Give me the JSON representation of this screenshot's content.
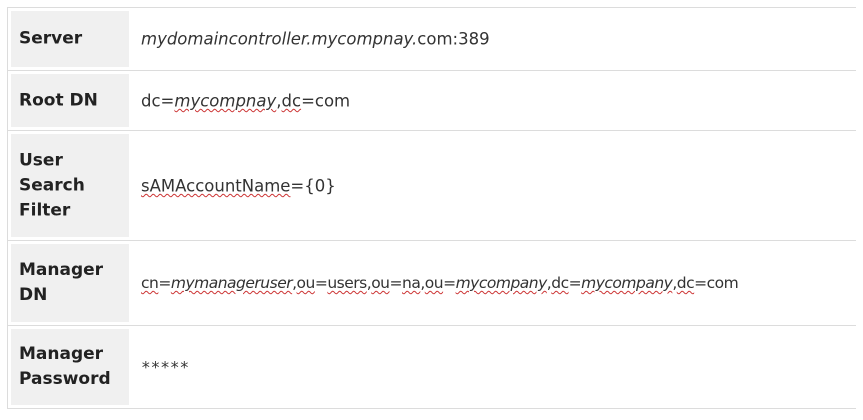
{
  "rows": [
    {
      "label": "Server",
      "value_parts": [
        {
          "text": "mydomaincontroller.mycompnay.",
          "style": "it"
        },
        {
          "text": "com:389",
          "style": ""
        }
      ]
    },
    {
      "label": "Root DN",
      "value_parts": [
        {
          "text": "dc=",
          "style": ""
        },
        {
          "text": "mycompnay",
          "style": "it sq"
        },
        {
          "text": ",",
          "style": ""
        },
        {
          "text": "dc",
          "style": "sq"
        },
        {
          "text": "=com",
          "style": ""
        }
      ]
    },
    {
      "label": "User\nSearch\nFilter",
      "value_parts": [
        {
          "text": "sAMAccountName",
          "style": "sq"
        },
        {
          "text": "={0}",
          "style": ""
        }
      ]
    },
    {
      "label": "Manager\nDN",
      "value_parts": [
        {
          "text": "cn",
          "style": "sq"
        },
        {
          "text": "=",
          "style": ""
        },
        {
          "text": "mymanageruser",
          "style": "it sq"
        },
        {
          "text": ",",
          "style": ""
        },
        {
          "text": "ou",
          "style": "sq"
        },
        {
          "text": "=",
          "style": ""
        },
        {
          "text": "users",
          "style": "sq"
        },
        {
          "text": ",",
          "style": ""
        },
        {
          "text": "ou",
          "style": "sq"
        },
        {
          "text": "=",
          "style": ""
        },
        {
          "text": "na",
          "style": "sq"
        },
        {
          "text": ",",
          "style": ""
        },
        {
          "text": "ou",
          "style": "sq"
        },
        {
          "text": "=",
          "style": ""
        },
        {
          "text": "mycompany",
          "style": "it sq"
        },
        {
          "text": ",",
          "style": ""
        },
        {
          "text": "dc",
          "style": "sq"
        },
        {
          "text": "=",
          "style": ""
        },
        {
          "text": "mycompany",
          "style": "it sq"
        },
        {
          "text": ",",
          "style": ""
        },
        {
          "text": "dc",
          "style": "sq"
        },
        {
          "text": "=com",
          "style": ""
        }
      ]
    },
    {
      "label": "Manager\nPassword",
      "value_parts": [
        {
          "text": "*****",
          "style": "mono"
        }
      ]
    }
  ]
}
